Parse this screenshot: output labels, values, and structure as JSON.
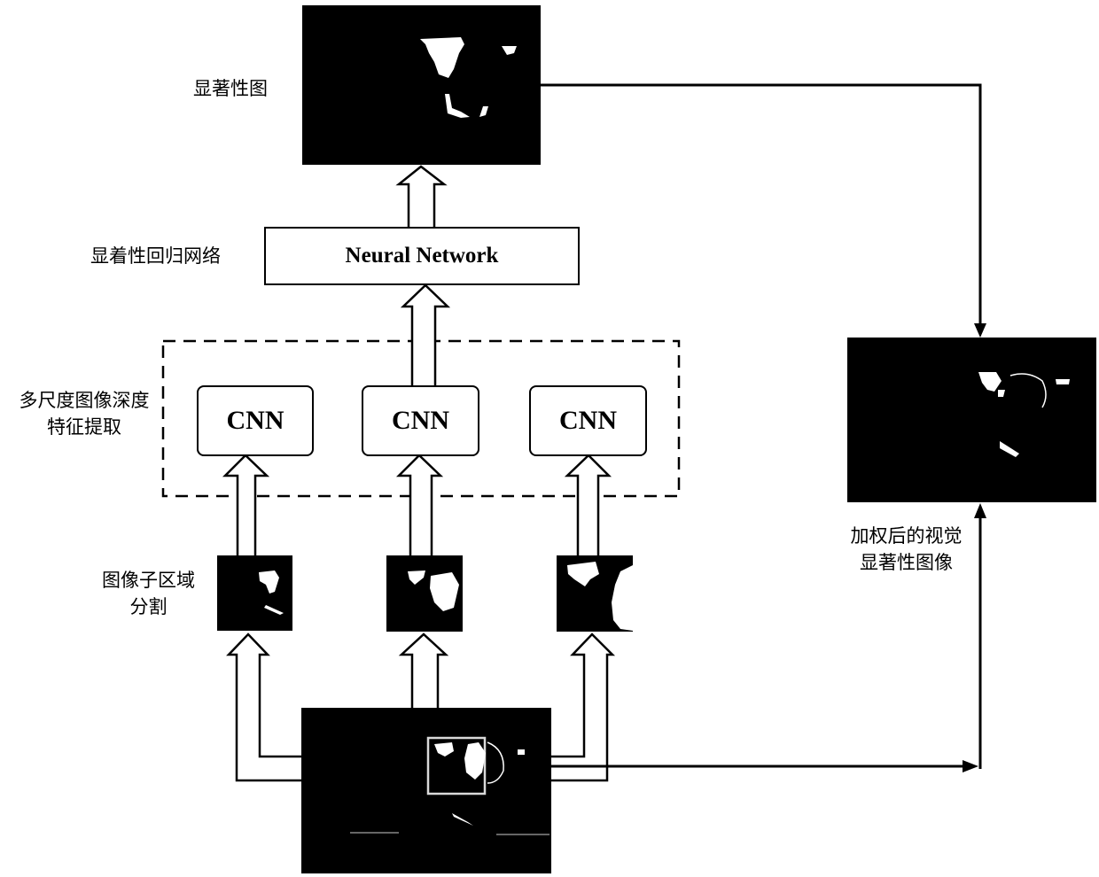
{
  "labels": {
    "saliency_map": "显著性图",
    "saliency_regression": "显着性回归网络",
    "multiscale_feature_line1": "多尺度图像深度",
    "multiscale_feature_line2": "特征提取",
    "subregion_line1": "图像子区域",
    "subregion_line2": "分割",
    "weighted_line1": "加权后的视觉",
    "weighted_line2": "显著性图像"
  },
  "blocks": {
    "neural_network": "Neural Network",
    "cnn": [
      "CNN",
      "CNN",
      "CNN"
    ]
  },
  "images": {
    "saliency_map": "binary saliency map (white blobs on black)",
    "sub_regions": [
      "small-scale crop",
      "medium-scale crop",
      "large-scale crop"
    ],
    "input": "input image with highlighted region box",
    "output": "weighted visual saliency image"
  },
  "colors": {
    "line": "#000000",
    "background": "#ffffff",
    "image_bg": "#000000",
    "highlight_box": "#d9d9d9"
  }
}
